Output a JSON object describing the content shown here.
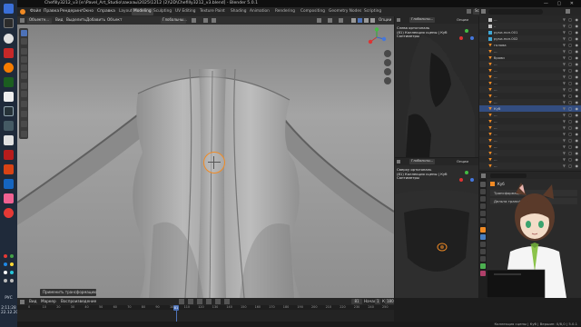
{
  "window": {
    "title": "Chefilly3212_v3 [e:\\Pavel_Art_Studio\\заказы\\2025\\1212 (2)\\2D\\Chefilly3212_v3.blend] - Blender 5.0.1"
  },
  "menubar": {
    "items": [
      "Файл",
      "Правка",
      "Рендеринг",
      "Окно",
      "Справка"
    ],
    "workspaces": [
      "Layout",
      "Modeling",
      "Sculpting",
      "UV Editing",
      "Texture Paint",
      "Shading",
      "Animation",
      "Rendering",
      "Compositing",
      "Geometry Nodes",
      "Scripting"
    ],
    "active_workspace": "Sculpting",
    "scene": "Scene",
    "view_layer": "ViewLayer"
  },
  "viewport_main": {
    "mode": "Объектн...",
    "menus": [
      "Вид",
      "Выделить",
      "Добавить",
      "Объект"
    ],
    "orientation": "Глобальны...",
    "options_label": "Опции"
  },
  "viewport_top": {
    "orientation": "Глобальны...",
    "options_label": "Опции",
    "info_lines": [
      "Слева ортогональ",
      "(81) Коллекция сцены | Куб",
      "Сантиметры"
    ]
  },
  "viewport_bottom": {
    "orientation": "Глобальны...",
    "options_label": "Опции",
    "info_lines": [
      "Сверху ортогональ",
      "(81) Коллекция сцены | Куб",
      "Сантиметры"
    ]
  },
  "operator_panel": {
    "label": "Применить трансформацию"
  },
  "timeline": {
    "menus": [
      "Вид",
      "Маркер",
      "Воспроизведение"
    ],
    "current_frame": "81",
    "start_label": "Начало",
    "start": "1",
    "end_label": "Кон.",
    "end": "180",
    "ruler": [
      "0",
      "10",
      "20",
      "30",
      "40",
      "50",
      "60",
      "70",
      "80",
      "90",
      "100",
      "110",
      "120",
      "130",
      "140",
      "150",
      "160",
      "170",
      "180",
      "190",
      "200",
      "210",
      "220",
      "230",
      "240",
      "250"
    ]
  },
  "statusbar": {
    "right_text": "Коллекция сцены | Куб | Вершин: 0/8,0 | 5.0.1"
  },
  "outliner": {
    "search_placeholder": "",
    "rows": [
      {
        "name": "...",
        "icon": "object"
      },
      {
        "name": "..",
        "icon": "object"
      },
      {
        "name": "руки-пол.001",
        "icon": "modifier"
      },
      {
        "name": "руки-пол.002",
        "icon": "modifier"
      },
      {
        "name": "голова",
        "icon": "mesh"
      },
      {
        "name": "...",
        "icon": "mesh"
      },
      {
        "name": "брови",
        "icon": "mesh"
      },
      {
        "name": "...",
        "icon": "mesh"
      },
      {
        "name": "...",
        "icon": "mesh"
      },
      {
        "name": "...",
        "icon": "mesh"
      },
      {
        "name": "...",
        "icon": "mesh"
      },
      {
        "name": "...",
        "icon": "mesh"
      },
      {
        "name": "...",
        "icon": "mesh"
      },
      {
        "name": "...",
        "icon": "mesh"
      },
      {
        "name": "Куб",
        "icon": "mesh",
        "selected": true
      },
      {
        "name": "...",
        "icon": "mesh"
      },
      {
        "name": "...",
        "icon": "mesh"
      },
      {
        "name": "...",
        "icon": "mesh"
      },
      {
        "name": "...",
        "icon": "mesh"
      },
      {
        "name": "...",
        "icon": "mesh"
      },
      {
        "name": "...",
        "icon": "mesh"
      },
      {
        "name": "...",
        "icon": "mesh"
      },
      {
        "name": "...",
        "icon": "mesh"
      },
      {
        "name": "...",
        "icon": "mesh"
      }
    ]
  },
  "properties": {
    "object_name": "Куб",
    "sections": [
      "Трансформация",
      "Дельта трансформации"
    ]
  },
  "taskbar": {
    "lang": "РУС",
    "time": "2:11:28",
    "date": "22.12.2025"
  },
  "colors": {
    "accent": "#4d72b8",
    "selection": "#334d80",
    "orange": "#f08a24",
    "viewport_bg": "#9b9b9b"
  }
}
